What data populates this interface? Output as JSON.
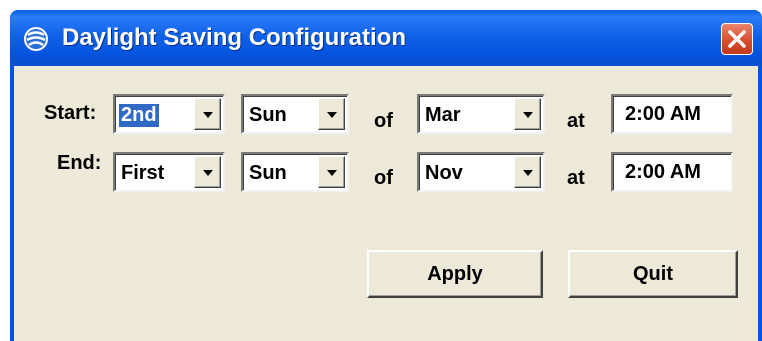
{
  "window": {
    "title": "Daylight Saving Configuration",
    "icon": "app-globe-icon",
    "close_icon": "close-icon"
  },
  "start": {
    "label": "Start:",
    "week": "2nd",
    "day": "Sun",
    "of_label": "of",
    "month": "Mar",
    "at_label": "at",
    "time": "2:00 AM"
  },
  "end": {
    "label": "End:",
    "week": "First",
    "day": "Sun",
    "of_label": "of",
    "month": "Nov",
    "at_label": "at",
    "time": "2:00 AM"
  },
  "buttons": {
    "apply": "Apply",
    "quit": "Quit"
  },
  "colors": {
    "titlebar": "#0553dd",
    "client_bg": "#ece9d8",
    "close_button": "#d8492a",
    "selection": "#316ac5"
  }
}
